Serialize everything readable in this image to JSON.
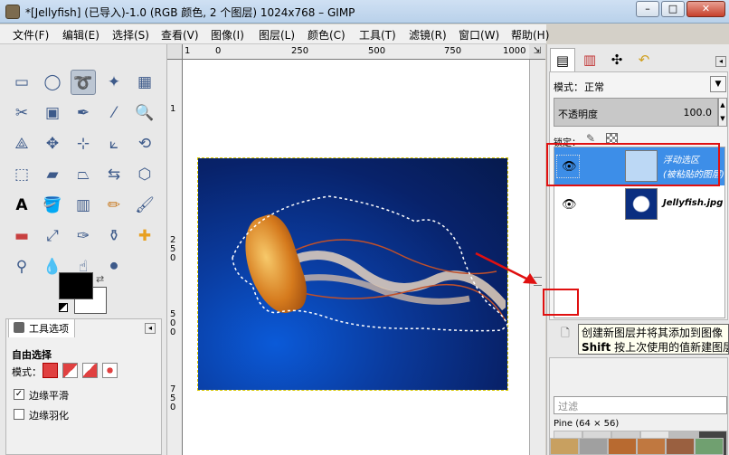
{
  "window": {
    "title": "*[Jellyfish] (已导入)-1.0 (RGB 颜色, 2 个图层) 1024x768 – GIMP",
    "minimize": "–",
    "maximize": "□",
    "close": "✕"
  },
  "menu": [
    "文件(F)",
    "编辑(E)",
    "选择(S)",
    "查看(V)",
    "图像(I)",
    "图层(L)",
    "颜色(C)",
    "工具(T)",
    "滤镜(R)",
    "窗口(W)",
    "帮助(H)"
  ],
  "tool_options": {
    "tab_label": "工具选项",
    "title": "自由选择",
    "mode_label": "模式：",
    "antialias_label": "边缘平滑",
    "antialias_checked": "✓",
    "feather_label": "边缘羽化"
  },
  "ruler": {
    "h_labels": [
      "0",
      "250",
      "500",
      "750",
      "1000"
    ],
    "v_labels": [
      "250",
      "500",
      "750"
    ],
    "h_prefix": "1",
    "v_prefix": "1"
  },
  "layers": {
    "mode_label": "模式：",
    "mode_value": "正常",
    "opacity_label": "不透明度",
    "opacity_value": "100.0",
    "lock_label": "锁定：",
    "items": [
      {
        "name_line1": "浮动选区",
        "name_line2": "(被粘贴的图层)",
        "selected": true
      },
      {
        "name_line1": "Jellyfish.jpg",
        "name_line2": "",
        "selected": false
      }
    ]
  },
  "tooltip": {
    "line1": "创建新图层并将其添加到图像",
    "line2_key": "Shift",
    "line2_text": "按上次使用的值新建图层"
  },
  "brushes": {
    "filter_placeholder": "过滤",
    "brush_name": "Pine (64 × 56)"
  },
  "colors": {
    "selection_highlight": "#3d8ee8",
    "annotation_red": "#e01010",
    "foreground": "#000000",
    "background": "#ffffff"
  }
}
